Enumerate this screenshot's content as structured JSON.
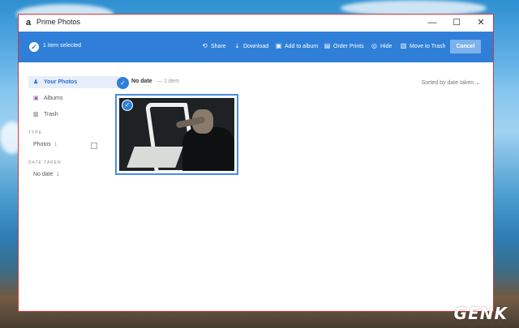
{
  "window": {
    "title": "Prime Photos",
    "app_icon": "a"
  },
  "window_controls": {
    "minimize": "—",
    "maximize": "☐",
    "close": "✕"
  },
  "toolbar": {
    "selection_text": "1 item selected",
    "actions": [
      {
        "label": "Share",
        "icon": "share-icon"
      },
      {
        "label": "Download",
        "icon": "download-icon"
      },
      {
        "label": "Add to album",
        "icon": "album-icon"
      },
      {
        "label": "Order Prints",
        "icon": "prints-icon"
      },
      {
        "label": "Hide",
        "icon": "hide-icon"
      },
      {
        "label": "Move to Trash",
        "icon": "trash-icon"
      }
    ],
    "cancel_label": "Cancel"
  },
  "sidebar": {
    "items": [
      {
        "label": "Your Photos",
        "icon": "person-icon",
        "active": true
      },
      {
        "label": "Albums",
        "icon": "album-icon",
        "active": false
      },
      {
        "label": "Trash",
        "icon": "trash-icon",
        "active": false
      }
    ],
    "type_heading": "TYPE",
    "type_facets": [
      {
        "label": "Photos",
        "count": "1"
      }
    ],
    "date_heading": "DATE TAKEN",
    "date_facets": [
      {
        "label": "No date",
        "count": "1"
      }
    ]
  },
  "main": {
    "group_title": "No date",
    "group_count": "— 1 item",
    "sort_label": "Sorted by date taken ⌄"
  },
  "watermark": "GENK",
  "colors": {
    "accent": "#2f7fd8",
    "window_border": "#d23a3a"
  }
}
